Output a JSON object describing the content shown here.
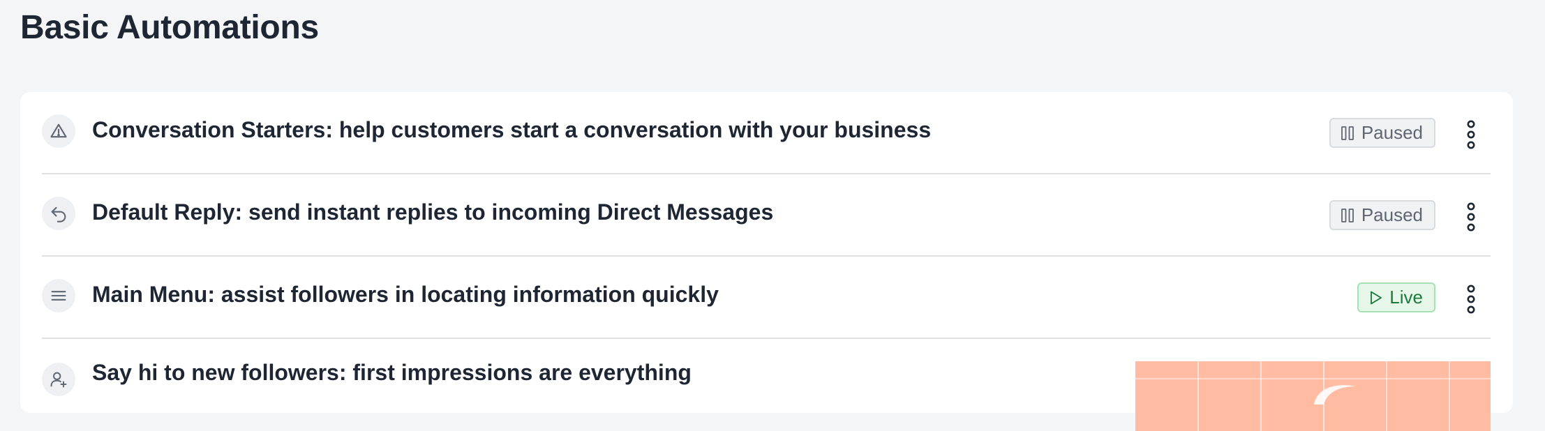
{
  "page": {
    "title": "Basic Automations"
  },
  "automations": [
    {
      "icon": "warning-triangle-icon",
      "label": "Conversation Starters: help customers start a conversation with your business",
      "status": "Paused",
      "status_type": "paused"
    },
    {
      "icon": "reply-arrow-icon",
      "label": "Default Reply: send instant replies to incoming Direct Messages",
      "status": "Paused",
      "status_type": "paused"
    },
    {
      "icon": "menu-lines-icon",
      "label": "Main Menu: assist followers in locating information quickly",
      "status": "Live",
      "status_type": "live"
    },
    {
      "icon": "add-user-icon",
      "label": "Say hi to new followers: first impressions are everything"
    }
  ],
  "colors": {
    "page_background": "#f4f5f7",
    "card_background": "#ffffff",
    "paused": "#5e6672",
    "live": "#1d7a3d",
    "preview_fill": "#ffbca3"
  }
}
